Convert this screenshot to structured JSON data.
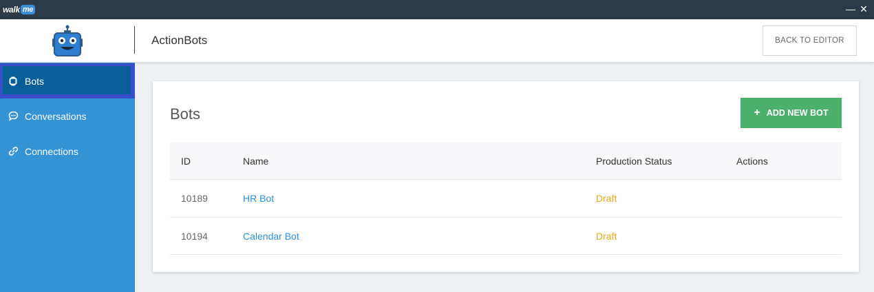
{
  "titlebar": {
    "logo_walk": "walk",
    "logo_me": "me",
    "minimize": "—",
    "close": "✕"
  },
  "header": {
    "app_title": "ActionBots",
    "back_button": "BACK TO EDITOR"
  },
  "sidebar": {
    "items": [
      {
        "label": "Bots",
        "icon": "watch-icon",
        "active": true
      },
      {
        "label": "Conversations",
        "icon": "chat-bubble-icon",
        "active": false
      },
      {
        "label": "Connections",
        "icon": "link-icon",
        "active": false
      }
    ]
  },
  "main": {
    "title": "Bots",
    "add_button": "ADD NEW BOT",
    "columns": [
      "ID",
      "Name",
      "Production Status",
      "Actions"
    ],
    "rows": [
      {
        "id": "10189",
        "name": "HR Bot",
        "status": "Draft"
      },
      {
        "id": "10194",
        "name": "Calendar Bot",
        "status": "Draft"
      }
    ]
  },
  "colors": {
    "titlebar": "#2c3a4a",
    "sidebar": "#3393d4",
    "sidebar_active": "#085f98",
    "add_button": "#4caf6b",
    "link": "#2a90d8",
    "draft": "#e6a817"
  }
}
